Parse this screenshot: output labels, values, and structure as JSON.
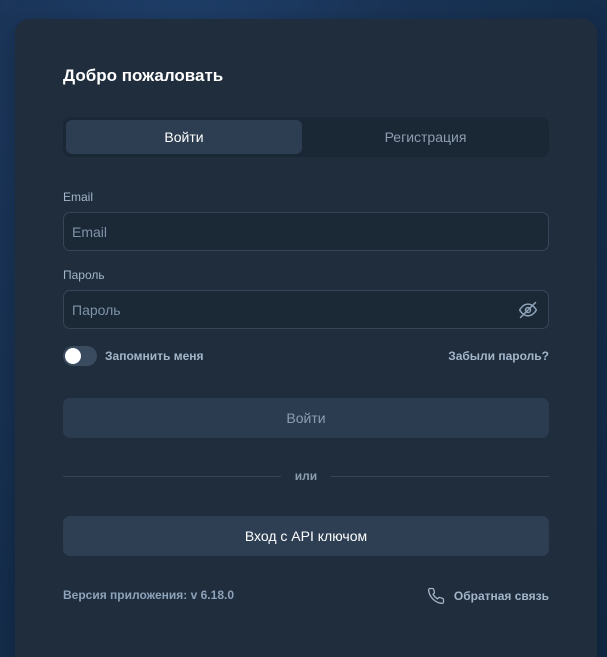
{
  "title": "Добро пожаловать",
  "tabs": {
    "login": "Войти",
    "register": "Регистрация"
  },
  "email": {
    "label": "Email",
    "placeholder": "Email",
    "value": ""
  },
  "password": {
    "label": "Пароль",
    "placeholder": "Пароль",
    "value": "",
    "toggle_icon": "eye-off-icon"
  },
  "remember": {
    "label": "Запомнить меня",
    "checked": false
  },
  "forgot_password": "Забыли пароль?",
  "login_button": "Войти",
  "divider": "или",
  "api_button": "Вход с API ключом",
  "version": "Версия приложения: v 6.18.0",
  "feedback": {
    "label": "Обратная связь",
    "icon": "phone-icon"
  },
  "colors": {
    "card": "#1f2d3d",
    "accent_text": "#a3b6ca",
    "button": "#2e3f54"
  }
}
